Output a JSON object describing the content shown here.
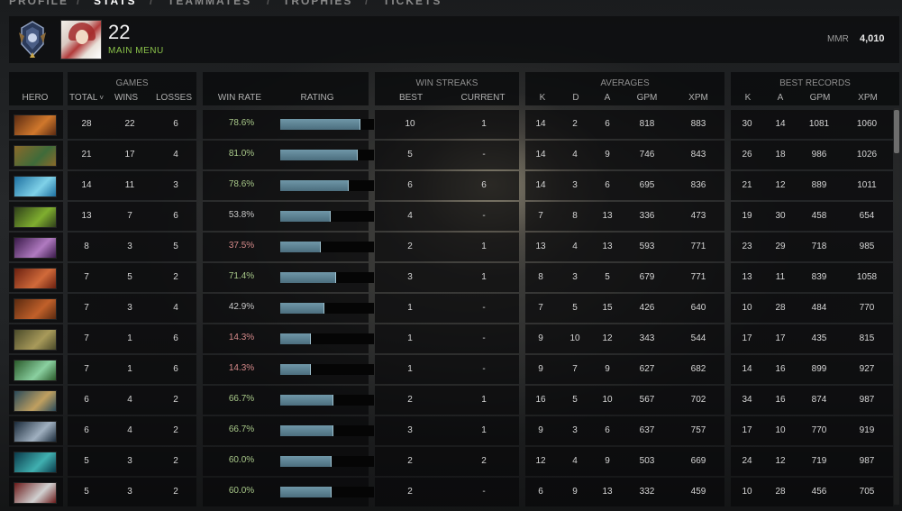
{
  "nav": {
    "items": [
      "PROFILE",
      "STATS",
      "TEAMMATES",
      "TROPHIES",
      "TICKETS"
    ],
    "separator": "/",
    "active": "STATS"
  },
  "profile": {
    "level": "22",
    "main_menu": "MAIN MENU",
    "mmr_label": "MMR",
    "mmr_value": "4,010"
  },
  "groups": {
    "games": "GAMES",
    "win_streaks": "WIN STREAKS",
    "averages": "AVERAGES",
    "best_records": "BEST RECORDS"
  },
  "columns": {
    "hero": "HERO",
    "total": "TOTAL",
    "sort_icon": "˅",
    "wins": "WINS",
    "losses": "LOSSES",
    "win_rate": "WIN RATE",
    "rating": "RATING",
    "best": "BEST",
    "current": "CURRENT",
    "avg_k": "K",
    "avg_d": "D",
    "avg_a": "A",
    "avg_gpm": "GPM",
    "avg_xpm": "XPM",
    "best_k": "K",
    "best_a": "A",
    "best_gpm": "GPM",
    "best_xpm": "XPM"
  },
  "rows": [
    {
      "hero_colors": [
        "#5a2a12",
        "#d0782c"
      ],
      "total": "28",
      "wins": "22",
      "losses": "6",
      "win_rate": "78.6%",
      "wr_level": "high",
      "rating": 0.86,
      "best": "10",
      "current": "1",
      "k": "14",
      "d": "2",
      "a": "6",
      "gpm": "818",
      "xpm": "883",
      "bk": "30",
      "ba": "14",
      "bgpm": "1081",
      "bxpm": "1060"
    },
    {
      "hero_colors": [
        "#8a6a2a",
        "#3f6b3a"
      ],
      "total": "21",
      "wins": "17",
      "losses": "4",
      "win_rate": "81.0%",
      "wr_level": "high",
      "rating": 0.83,
      "best": "5",
      "current": "-",
      "k": "14",
      "d": "4",
      "a": "9",
      "gpm": "746",
      "xpm": "843",
      "bk": "26",
      "ba": "18",
      "bgpm": "986",
      "bxpm": "1026"
    },
    {
      "hero_colors": [
        "#1d6fa0",
        "#7fd1e8"
      ],
      "total": "14",
      "wins": "11",
      "losses": "3",
      "win_rate": "78.6%",
      "wr_level": "high",
      "rating": 0.73,
      "best": "6",
      "current": "6",
      "k": "14",
      "d": "3",
      "a": "6",
      "gpm": "695",
      "xpm": "836",
      "bk": "21",
      "ba": "12",
      "bgpm": "889",
      "bxpm": "1011"
    },
    {
      "hero_colors": [
        "#2f3f1a",
        "#7fae2f"
      ],
      "total": "13",
      "wins": "7",
      "losses": "6",
      "win_rate": "53.8%",
      "wr_level": "mid",
      "rating": 0.54,
      "best": "4",
      "current": "-",
      "k": "7",
      "d": "8",
      "a": "13",
      "gpm": "336",
      "xpm": "473",
      "bk": "19",
      "ba": "30",
      "bgpm": "458",
      "bxpm": "654"
    },
    {
      "hero_colors": [
        "#3a1a4a",
        "#b07ac0"
      ],
      "total": "8",
      "wins": "3",
      "losses": "5",
      "win_rate": "37.5%",
      "wr_level": "low",
      "rating": 0.43,
      "best": "2",
      "current": "1",
      "k": "13",
      "d": "4",
      "a": "13",
      "gpm": "593",
      "xpm": "771",
      "bk": "23",
      "ba": "29",
      "bgpm": "718",
      "bxpm": "985"
    },
    {
      "hero_colors": [
        "#6a2010",
        "#d06a3a"
      ],
      "total": "7",
      "wins": "5",
      "losses": "2",
      "win_rate": "71.4%",
      "wr_level": "high",
      "rating": 0.6,
      "best": "3",
      "current": "1",
      "k": "8",
      "d": "3",
      "a": "5",
      "gpm": "679",
      "xpm": "771",
      "bk": "13",
      "ba": "11",
      "bgpm": "839",
      "bxpm": "1058"
    },
    {
      "hero_colors": [
        "#5a2a10",
        "#c0602a"
      ],
      "total": "7",
      "wins": "3",
      "losses": "4",
      "win_rate": "42.9%",
      "wr_level": "mid",
      "rating": 0.47,
      "best": "1",
      "current": "-",
      "k": "7",
      "d": "5",
      "a": "15",
      "gpm": "426",
      "xpm": "640",
      "bk": "10",
      "ba": "28",
      "bgpm": "484",
      "bxpm": "770"
    },
    {
      "hero_colors": [
        "#4a4a2a",
        "#a89a5a"
      ],
      "total": "7",
      "wins": "1",
      "losses": "6",
      "win_rate": "14.3%",
      "wr_level": "low",
      "rating": 0.33,
      "best": "1",
      "current": "-",
      "k": "9",
      "d": "10",
      "a": "12",
      "gpm": "343",
      "xpm": "544",
      "bk": "17",
      "ba": "17",
      "bgpm": "435",
      "bxpm": "815"
    },
    {
      "hero_colors": [
        "#2a5a2a",
        "#8ad0a0"
      ],
      "total": "7",
      "wins": "1",
      "losses": "6",
      "win_rate": "14.3%",
      "wr_level": "low",
      "rating": 0.33,
      "best": "1",
      "current": "-",
      "k": "9",
      "d": "7",
      "a": "9",
      "gpm": "627",
      "xpm": "682",
      "bk": "14",
      "ba": "16",
      "bgpm": "899",
      "bxpm": "927"
    },
    {
      "hero_colors": [
        "#2a4a5a",
        "#c0a060"
      ],
      "total": "6",
      "wins": "4",
      "losses": "2",
      "win_rate": "66.7%",
      "wr_level": "high",
      "rating": 0.57,
      "best": "2",
      "current": "1",
      "k": "16",
      "d": "5",
      "a": "10",
      "gpm": "567",
      "xpm": "702",
      "bk": "34",
      "ba": "16",
      "bgpm": "874",
      "bxpm": "987"
    },
    {
      "hero_colors": [
        "#1a2a3a",
        "#a0b0c0"
      ],
      "total": "6",
      "wins": "4",
      "losses": "2",
      "win_rate": "66.7%",
      "wr_level": "high",
      "rating": 0.57,
      "best": "3",
      "current": "1",
      "k": "9",
      "d": "3",
      "a": "6",
      "gpm": "637",
      "xpm": "757",
      "bk": "17",
      "ba": "10",
      "bgpm": "770",
      "bxpm": "919"
    },
    {
      "hero_colors": [
        "#0a3a4a",
        "#40b0b0"
      ],
      "total": "5",
      "wins": "3",
      "losses": "2",
      "win_rate": "60.0%",
      "wr_level": "high",
      "rating": 0.55,
      "best": "2",
      "current": "2",
      "k": "12",
      "d": "4",
      "a": "9",
      "gpm": "503",
      "xpm": "669",
      "bk": "24",
      "ba": "12",
      "bgpm": "719",
      "bxpm": "987"
    },
    {
      "hero_colors": [
        "#6a1a1a",
        "#d0d0d0"
      ],
      "total": "5",
      "wins": "3",
      "losses": "2",
      "win_rate": "60.0%",
      "wr_level": "high",
      "rating": 0.55,
      "best": "2",
      "current": "-",
      "k": "6",
      "d": "9",
      "a": "13",
      "gpm": "332",
      "xpm": "459",
      "bk": "10",
      "ba": "28",
      "bgpm": "456",
      "bxpm": "705"
    }
  ]
}
